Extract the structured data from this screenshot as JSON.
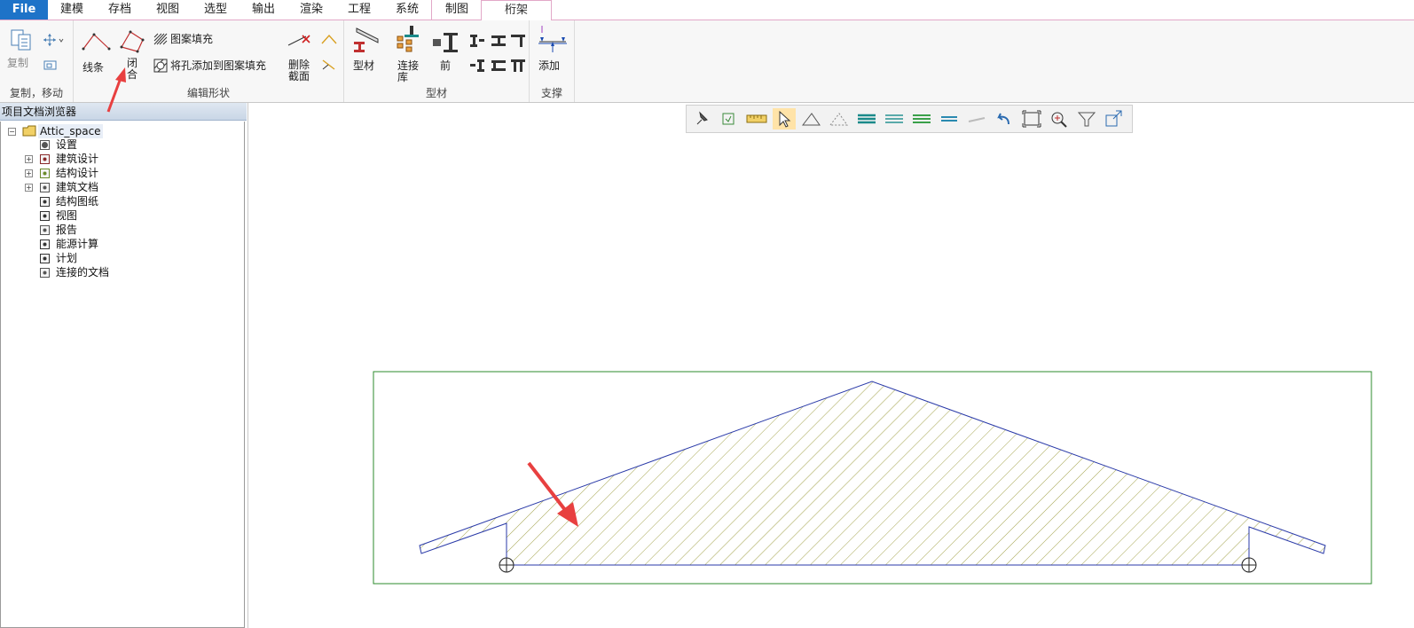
{
  "menu": {
    "file": "File",
    "items": [
      "建模",
      "存档",
      "视图",
      "选型",
      "输出",
      "渲染",
      "工程",
      "系统",
      "制图",
      "桁架"
    ],
    "active_index": 9
  },
  "ribbon": {
    "groups": {
      "copy_move": {
        "label": "复制，移动",
        "copy": "复制"
      },
      "edit_shape": {
        "label": "编辑形状",
        "line": "线条",
        "close_1": "闭",
        "close_2": "合",
        "pattern_fill": "图案填充",
        "add_hole": "将孔添加到图案填充",
        "delete_1": "删除",
        "delete_2": "截面"
      },
      "profile": {
        "label": "型材",
        "profile": "型材",
        "library_1": "连接",
        "library_2": "库",
        "front": "前"
      },
      "support": {
        "label": "支撑",
        "add": "添加"
      }
    }
  },
  "browser": {
    "title": "项目文档浏览器",
    "root": "Attic_space",
    "items": [
      {
        "label": "设置",
        "icon": "gear-icon",
        "expandable": false
      },
      {
        "label": "建筑设计",
        "icon": "building-icon",
        "expandable": true
      },
      {
        "label": "结构设计",
        "icon": "structure-icon",
        "expandable": true
      },
      {
        "label": "建筑文档",
        "icon": "document-set-icon",
        "expandable": true
      },
      {
        "label": "结构图纸",
        "icon": "drawing-icon",
        "expandable": false
      },
      {
        "label": "视图",
        "icon": "view-icon",
        "expandable": false
      },
      {
        "label": "报告",
        "icon": "report-icon",
        "expandable": false
      },
      {
        "label": "能源计算",
        "icon": "energy-icon",
        "expandable": false
      },
      {
        "label": "计划",
        "icon": "plan-icon",
        "expandable": false
      },
      {
        "label": "连接的文档",
        "icon": "linked-document-icon",
        "expandable": false
      }
    ]
  },
  "viewbar": {
    "icons": [
      "pin-icon",
      "refresh-icon",
      "ruler-icon",
      "select-arrow-icon",
      "triangle-icon",
      "dotted-triangle-icon",
      "layers-solid-icon",
      "layers-outline-icon",
      "layers-green-icon",
      "layers-blue-icon",
      "plane-icon",
      "undo-arrow-icon",
      "fit-frame-icon",
      "zoom-in-icon",
      "filter-icon",
      "export-icon"
    ]
  },
  "colors": {
    "accent": "#1e73c8",
    "truss_outline": "#2a3aa8",
    "hatch": "#9a9a3a",
    "frame": "#2e8b2e",
    "annotation_arrow": "#e84040"
  }
}
